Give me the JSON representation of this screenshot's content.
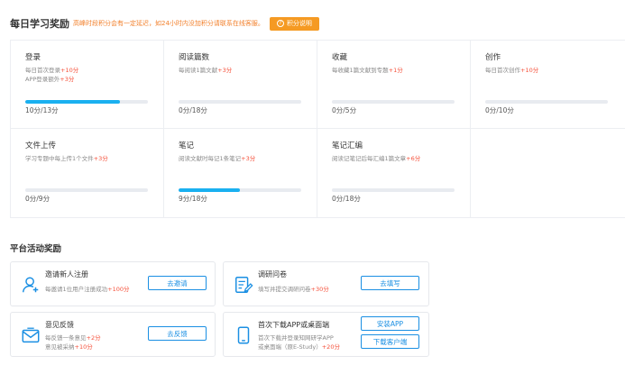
{
  "daily": {
    "title": "每日学习奖励",
    "note": "高峰时段积分会有一定延迟，如24小时内没加积分请联系在线客服。",
    "points_button": "积分说明"
  },
  "tasks": [
    {
      "name": "登录",
      "lines": [
        {
          "text": "每日首次登录",
          "pts": "+10分"
        },
        {
          "text": "APP登录额外",
          "pts": "+3分"
        }
      ],
      "progress_text": "10分/13分",
      "progress": 0.77
    },
    {
      "name": "阅读篇数",
      "lines": [
        {
          "text": "每阅读1篇文献",
          "pts": "+3分"
        }
      ],
      "progress_text": "0分/18分",
      "progress": 0
    },
    {
      "name": "收藏",
      "lines": [
        {
          "text": "每收藏1篇文献到专题",
          "pts": "+1分"
        }
      ],
      "progress_text": "0分/5分",
      "progress": 0
    },
    {
      "name": "创作",
      "lines": [
        {
          "text": "每日首次创作",
          "pts": "+10分"
        }
      ],
      "progress_text": "0分/10分",
      "progress": 0
    },
    {
      "name": "文件上传",
      "lines": [
        {
          "text": "学习专题中每上传1个文件",
          "pts": "+3分"
        }
      ],
      "progress_text": "0分/9分",
      "progress": 0
    },
    {
      "name": "笔记",
      "lines": [
        {
          "text": "阅读文献时每记1条笔记",
          "pts": "+3分"
        }
      ],
      "progress_text": "9分/18分",
      "progress": 0.5
    },
    {
      "name": "笔记汇编",
      "lines": [
        {
          "text": "阅读记笔记后每汇编1篇文章",
          "pts": "+6分"
        }
      ],
      "progress_text": "0分/18分",
      "progress": 0
    }
  ],
  "platform": {
    "title": "平台活动奖励",
    "invite": {
      "name": "邀请新人注册",
      "line1": "每邀请1位用户注册成功",
      "line1_pts": "+100分",
      "button": "去邀请"
    },
    "survey": {
      "name": "调研问卷",
      "line1": "填写并提交调研问卷",
      "line1_pts": "+30分",
      "button": "去填写"
    },
    "feedback": {
      "name": "意见反馈",
      "line1": "每反馈一条意见",
      "line1_pts": "+2分",
      "line2": "意见被采纳",
      "line2_pts": "+10分",
      "button": "去反馈"
    },
    "download": {
      "name": "首次下载APP或桌面端",
      "line1": "首次下载并登录知网研学APP",
      "line2": "或桌面端（原E-Study）",
      "line2_pts": "+20分",
      "button1": "安装APP",
      "button2": "下载客户端"
    }
  },
  "colors": {
    "accent_orange": "#f59a23",
    "points_red": "#f5503a",
    "progress_blue": "#1ab0f0",
    "link_blue": "#1a8fe3"
  }
}
